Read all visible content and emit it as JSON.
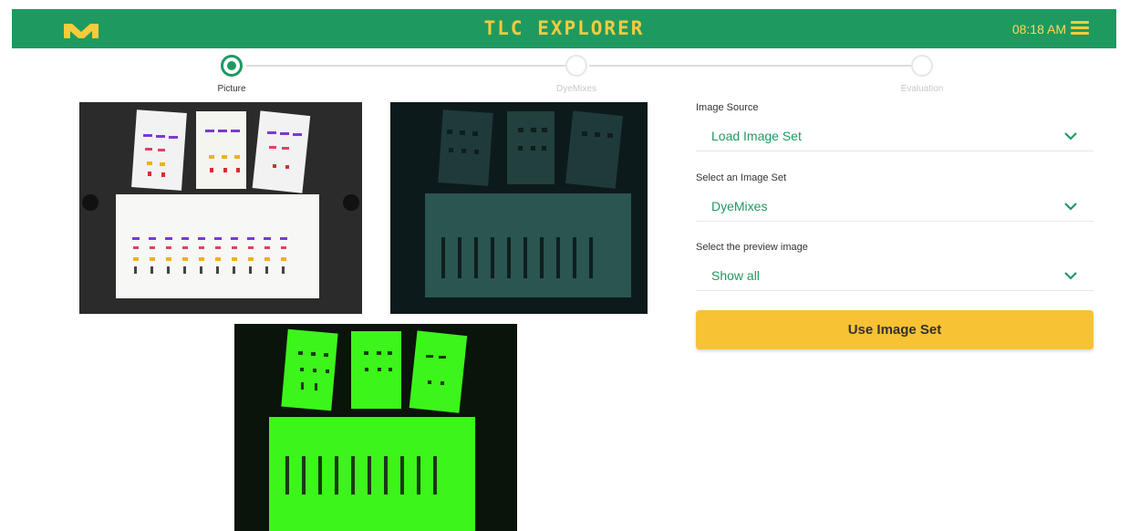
{
  "header": {
    "title": "TLC EXPLORER",
    "time": "08:18 AM",
    "logo_icon": "m-logo-icon",
    "menu_icon": "hamburger-menu-icon"
  },
  "stepper": {
    "steps": [
      {
        "label": "Picture",
        "active": true
      },
      {
        "label": "DyeMixes",
        "active": false
      },
      {
        "label": "Evaluation",
        "active": false
      }
    ]
  },
  "previews": [
    {
      "name": "white-light-image"
    },
    {
      "name": "uv-dark-image"
    },
    {
      "name": "green-fluorescent-image"
    }
  ],
  "form": {
    "image_source": {
      "label": "Image Source",
      "value": "Load Image Set"
    },
    "image_set": {
      "label": "Select an Image Set",
      "value": "DyeMixes"
    },
    "preview": {
      "label": "Select the preview image",
      "value": "Show all"
    },
    "submit_label": "Use Image Set"
  },
  "colors": {
    "brand_green": "#1e9a60",
    "accent_yellow": "#f7c234"
  }
}
